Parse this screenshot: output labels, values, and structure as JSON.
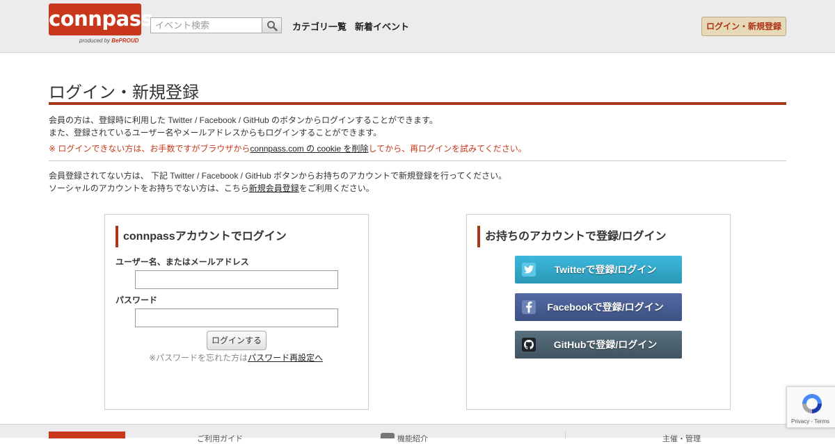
{
  "header": {
    "logo_text": "connpass",
    "logo_sub": "produced by",
    "logo_sub_brand": "BePROUD",
    "search_placeholder": "イベント検索",
    "nav": [
      "カテゴリ一覧",
      "新着イベント"
    ],
    "login_button": "ログイン・新規登録"
  },
  "main": {
    "title": "ログイン・新規登録",
    "intro1": "会員の方は、登録時に利用した Twitter / Facebook / GitHub のボタンからログインすることができます。",
    "intro2": "また、登録されているユーザー名やメールアドレスからもログインすることができます。",
    "warn_prefix": "※ ログインできない方は、お手数ですがブラウザから",
    "warn_link": "connpass.com の cookie を削除",
    "warn_suffix": "してから、再ログインを試みてください。",
    "reg1": "会員登録されてない方は、 下記 Twitter / Facebook / GitHub ボタンからお持ちのアカウントで新規登録を行ってください。",
    "reg2_prefix": "ソーシャルのアカウントをお持ちでない方は、こちら",
    "reg2_link": "新規会員登録",
    "reg2_suffix": "をご利用ください。"
  },
  "login_panel": {
    "heading": "connpassアカウントでログイン",
    "username_label": "ユーザー名、またはメールアドレス",
    "username_value": "",
    "password_label": "パスワード",
    "password_value": "",
    "submit": "ログインする",
    "forgot_prefix": "※パスワードを忘れた方は",
    "forgot_link": "パスワード再設定へ"
  },
  "sns_panel": {
    "heading": "お持ちのアカウントで登録/ログイン",
    "twitter": "Twitterで登録/ログイン",
    "facebook": "Facebookで登録/ログイン",
    "github": "GitHubで登録/ログイン"
  },
  "footer": {
    "guide": "ご利用ガイド",
    "features": "機能紹介",
    "right_text": "主催・管理"
  },
  "recaptcha": {
    "privacy": "Privacy",
    "sep": " - ",
    "terms": "Terms"
  },
  "colors": {
    "brand": "#c8371b",
    "rule": "#a6361a",
    "twitter": "#2fa8cc",
    "facebook": "#4a5f94",
    "github": "#4c616e"
  }
}
